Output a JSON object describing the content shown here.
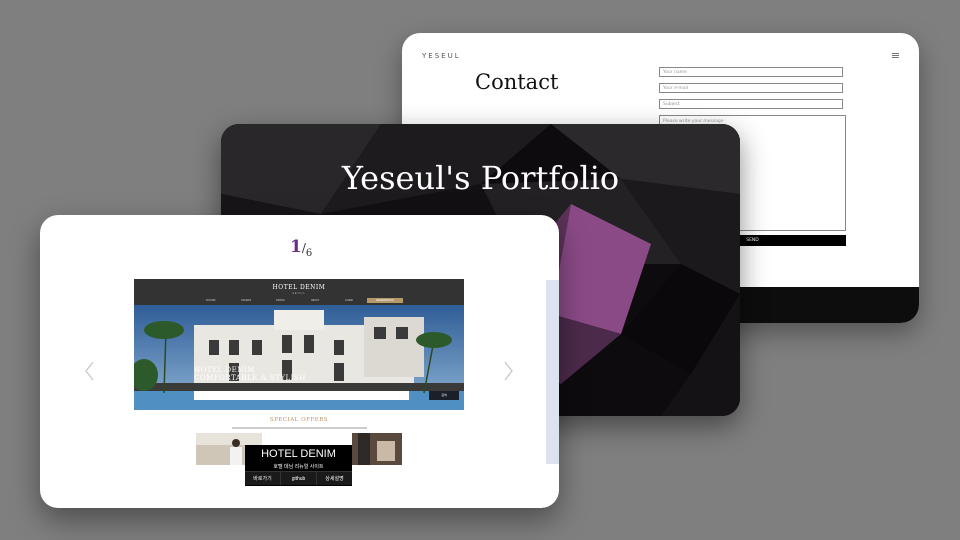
{
  "contact_card": {
    "logo": "YESEUL",
    "title": "Contact",
    "fields": {
      "name_placeholder": "Your name",
      "email_placeholder": "Your e-mail",
      "subject_placeholder": "Subject",
      "message_placeholder": "Please write your message"
    },
    "send_label": "SEND",
    "menu_icon": "hamburger-icon"
  },
  "portfolio_card": {
    "title": "Yeseul's Portfolio"
  },
  "slider_card": {
    "counter": {
      "current": "1",
      "total": "6"
    },
    "prev_icon": "chevron-left-icon",
    "next_icon": "chevron-right-icon",
    "site": {
      "logo": "HOTEL DENIM",
      "logo_sub": "SEOUL",
      "nav": [
        "ROOMS",
        "OFFERS",
        "DINING",
        "ABOUT",
        "GUIDE"
      ],
      "nav_button": "RESERVATION",
      "hero_line1": "HOTEL DENIM",
      "hero_line2": "COMFORTABLE & STYLISH",
      "booking_button": "검색",
      "special_title": "SPECIAL OFFERS"
    },
    "overlay": {
      "title": "HOTEL DENIM",
      "subtitle": "호텔 데님 리뉴얼 사이트",
      "buttons": [
        "바로가기",
        "github",
        "상세설명"
      ]
    }
  },
  "colors": {
    "background": "#7f7f7f",
    "counter_accent": "#6b2c8c",
    "special_offers": "#b49062",
    "reservation_btn": "#b49a6a"
  }
}
